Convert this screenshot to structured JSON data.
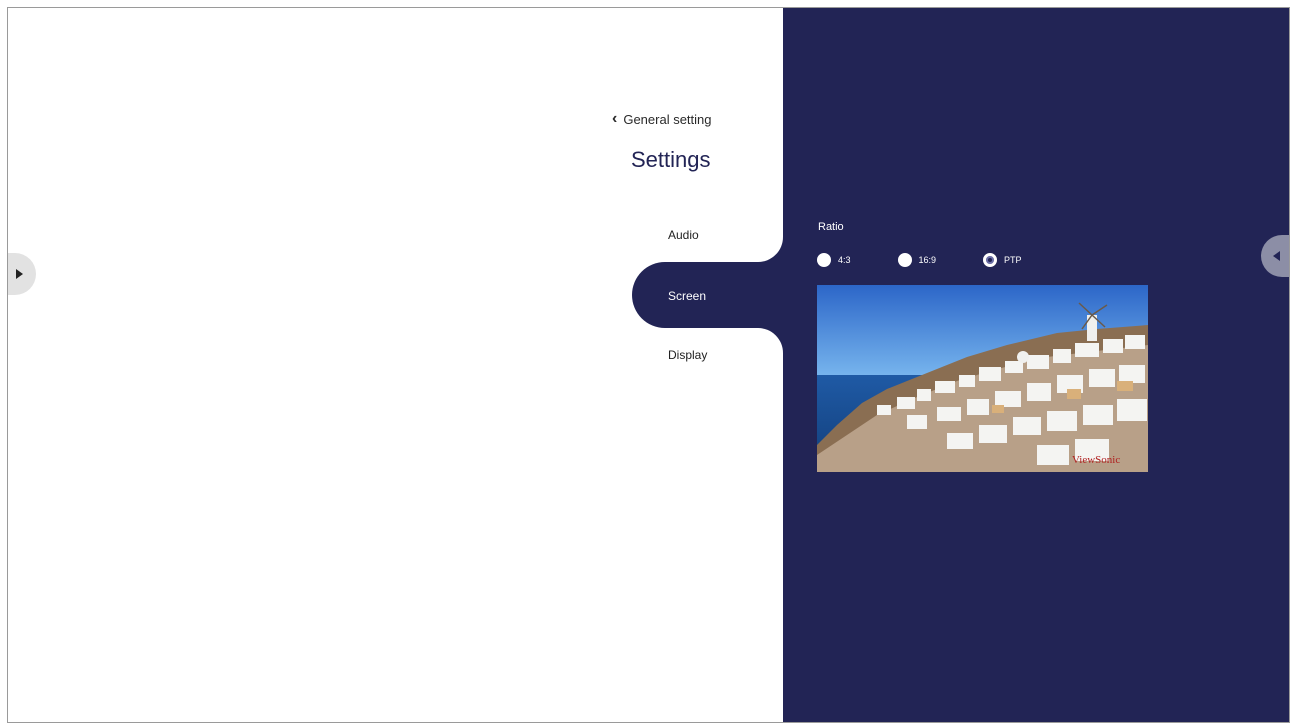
{
  "header": {
    "back_label": "General setting",
    "back_icon": "chevron-left-icon",
    "title": "Settings"
  },
  "nav": {
    "items": [
      {
        "label": "Audio",
        "selected": false
      },
      {
        "label": "Screen",
        "selected": true
      },
      {
        "label": "Display",
        "selected": false
      }
    ]
  },
  "screen_panel": {
    "ratio_label": "Ratio",
    "options": [
      {
        "label": "4:3",
        "selected": false
      },
      {
        "label": "16:9",
        "selected": false
      },
      {
        "label": "PTP",
        "selected": true
      }
    ],
    "preview_image": "coastal-village-photo"
  },
  "side_controls": {
    "left_icon": "play-arrow-icon",
    "right_icon": "back-arrow-icon"
  },
  "colors": {
    "panel_bg": "#222455",
    "page_bg": "#ffffff",
    "accent_text": "#222455"
  }
}
